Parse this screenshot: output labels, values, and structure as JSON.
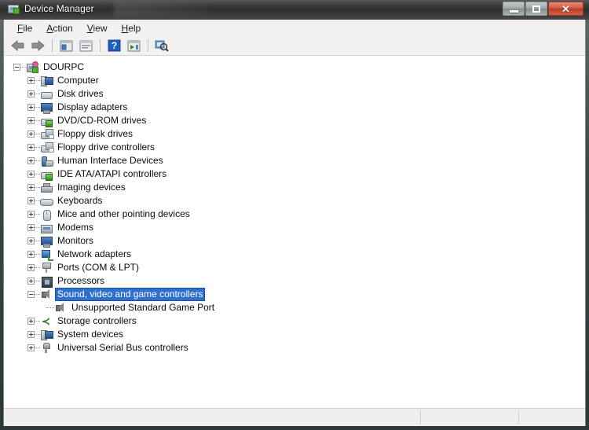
{
  "window": {
    "title": "Device Manager",
    "title_icon": "device-manager-icon",
    "buttons": {
      "minimize": "minimize-button",
      "maximize": "maximize-button",
      "close": "✕"
    }
  },
  "menubar": {
    "items": [
      {
        "name": "file",
        "accel": "F",
        "rest": "ile"
      },
      {
        "name": "action",
        "accel": "A",
        "rest": "ction"
      },
      {
        "name": "view",
        "accel": "V",
        "rest": "iew"
      },
      {
        "name": "help",
        "accel": "H",
        "rest": "elp"
      }
    ]
  },
  "toolbar": {
    "items": [
      {
        "name": "back-button",
        "icon": "back-arrow-icon",
        "type": "arrow-back"
      },
      {
        "name": "forward-button",
        "icon": "forward-arrow-icon",
        "type": "arrow-forward"
      },
      {
        "name": "separator-1",
        "icon": "separator",
        "type": "sep"
      },
      {
        "name": "show-hide-console-tree-button",
        "icon": "console-tree-icon",
        "type": "panel"
      },
      {
        "name": "properties-button",
        "icon": "properties-icon",
        "type": "props"
      },
      {
        "name": "separator-2",
        "icon": "separator",
        "type": "sep"
      },
      {
        "name": "help-button",
        "icon": "help-question-icon",
        "type": "help"
      },
      {
        "name": "update-driver-button",
        "icon": "update-driver-icon",
        "type": "panelplay"
      },
      {
        "name": "separator-3",
        "icon": "separator",
        "type": "sep"
      },
      {
        "name": "scan-for-hardware-changes-button",
        "icon": "scan-hardware-icon",
        "type": "scan"
      }
    ]
  },
  "tree": {
    "root": {
      "label": "DOURPC",
      "icon": "computer-root-icon",
      "expanded": true,
      "indent": 0
    },
    "nodes": [
      {
        "label": "Computer",
        "icon": "computer-icon",
        "state": "collapsed",
        "indent": 1
      },
      {
        "label": "Disk drives",
        "icon": "disk-drive-icon",
        "state": "collapsed",
        "indent": 1
      },
      {
        "label": "Display adapters",
        "icon": "display-adapter-icon",
        "state": "collapsed",
        "indent": 1
      },
      {
        "label": "DVD/CD-ROM drives",
        "icon": "dvd-drive-icon",
        "state": "collapsed",
        "indent": 1
      },
      {
        "label": "Floppy disk drives",
        "icon": "floppy-disk-icon",
        "state": "collapsed",
        "indent": 1
      },
      {
        "label": "Floppy drive controllers",
        "icon": "floppy-controller-icon",
        "state": "collapsed",
        "indent": 1
      },
      {
        "label": "Human Interface Devices",
        "icon": "hid-icon",
        "state": "collapsed",
        "indent": 1
      },
      {
        "label": "IDE ATA/ATAPI controllers",
        "icon": "ide-controller-icon",
        "state": "collapsed",
        "indent": 1
      },
      {
        "label": "Imaging devices",
        "icon": "imaging-device-icon",
        "state": "collapsed",
        "indent": 1
      },
      {
        "label": "Keyboards",
        "icon": "keyboard-icon",
        "state": "collapsed",
        "indent": 1
      },
      {
        "label": "Mice and other pointing devices",
        "icon": "mouse-icon",
        "state": "collapsed",
        "indent": 1
      },
      {
        "label": "Modems",
        "icon": "modem-icon",
        "state": "collapsed",
        "indent": 1
      },
      {
        "label": "Monitors",
        "icon": "monitor-icon",
        "state": "collapsed",
        "indent": 1
      },
      {
        "label": "Network adapters",
        "icon": "network-adapter-icon",
        "state": "collapsed",
        "indent": 1
      },
      {
        "label": "Ports (COM & LPT)",
        "icon": "port-icon",
        "state": "collapsed",
        "indent": 1
      },
      {
        "label": "Processors",
        "icon": "processor-icon",
        "state": "collapsed",
        "indent": 1
      },
      {
        "label": "Sound, video and game controllers",
        "icon": "sound-controller-icon",
        "state": "expanded",
        "indent": 1,
        "selected": true
      },
      {
        "label": "Unsupported Standard Game Port",
        "icon": "sound-controller-icon",
        "state": "leaf",
        "indent": 2
      },
      {
        "label": "Storage controllers",
        "icon": "storage-controller-icon",
        "state": "collapsed",
        "indent": 1
      },
      {
        "label": "System devices",
        "icon": "system-device-icon",
        "state": "collapsed",
        "indent": 1
      },
      {
        "label": "Universal Serial Bus controllers",
        "icon": "usb-controller-icon",
        "state": "collapsed",
        "indent": 1
      }
    ]
  },
  "statusbar": {
    "panels": [
      "",
      "",
      ""
    ]
  },
  "colors": {
    "selection_bg": "#2f6fd0",
    "selection_text": "#ffffff",
    "titlebar": "#2b2b2b",
    "close_button": "#b83a26",
    "content_bg": "#ffffff",
    "chrome_bg": "#f2f0ee",
    "window_border": "#2d3838"
  }
}
